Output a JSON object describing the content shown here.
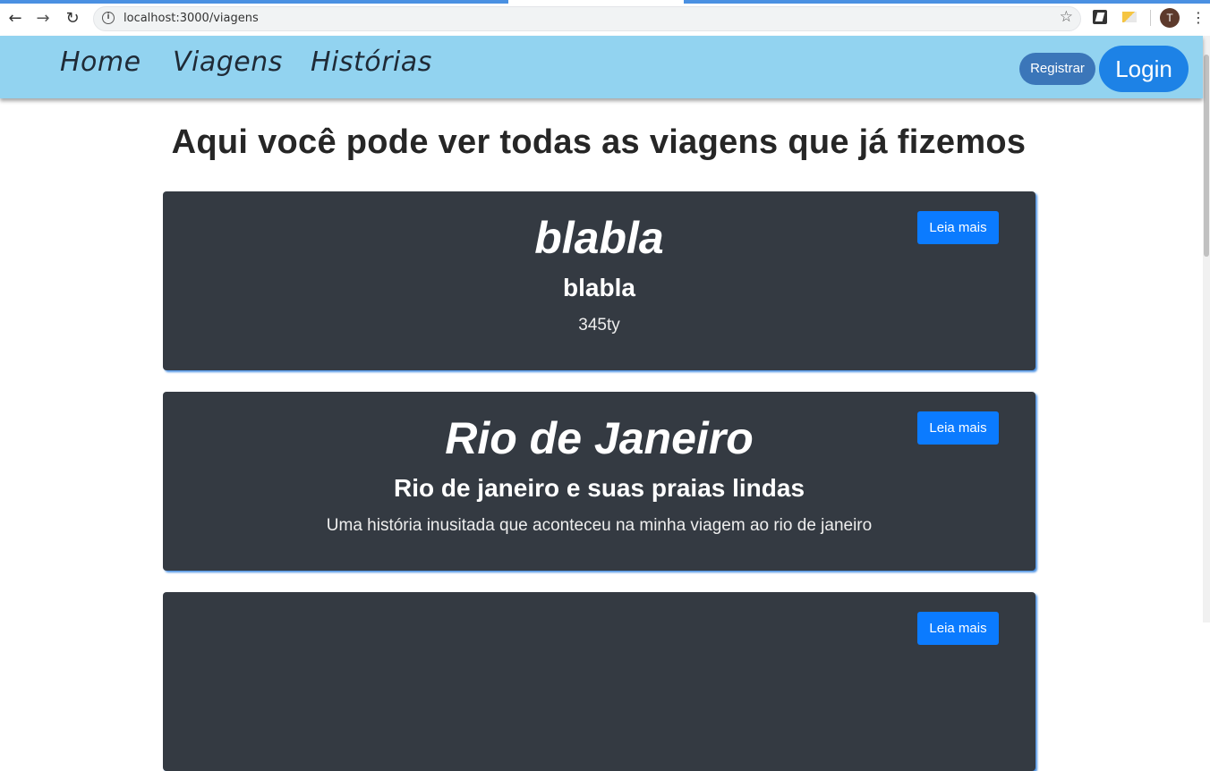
{
  "browser": {
    "url": "localhost:3000/viagens",
    "avatar_initial": "T"
  },
  "navbar": {
    "links": [
      "Home",
      "Viagens",
      "Histórias"
    ],
    "register_label": "Registrar",
    "login_label": "Login"
  },
  "main": {
    "heading": "Aqui você pode ver todas as viagens que já fizemos",
    "read_more_label": "Leia mais",
    "cards": [
      {
        "title": "blabla",
        "subtitle": "blabla",
        "description": "345ty"
      },
      {
        "title": "Rio de Janeiro",
        "subtitle": "Rio de janeiro e suas praias lindas",
        "description": "Uma história inusitada que aconteceu na minha viagem ao rio de janeiro"
      },
      {
        "title": "",
        "subtitle": "",
        "description": ""
      }
    ]
  },
  "colors": {
    "navbar_bg": "#92d3f0",
    "card_bg": "#343a42",
    "button_primary": "#0b7bff",
    "login_button": "#1d82e6",
    "register_button": "#3b76b9"
  }
}
